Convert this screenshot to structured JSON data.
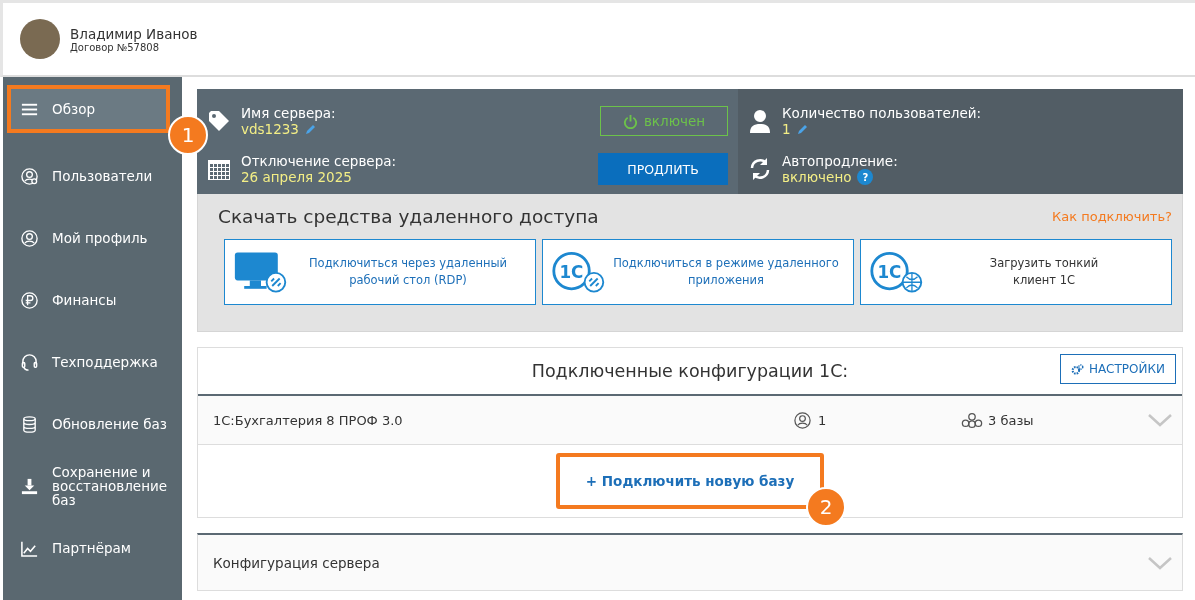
{
  "user": {
    "name": "Владимир Иванов",
    "contract": "Договор №57808"
  },
  "sidebar": {
    "items": [
      {
        "kind": "menu",
        "label": "Обзор",
        "selected": true,
        "callout": "1"
      },
      {
        "kind": "users",
        "label": "Пользователи",
        "selected": false
      },
      {
        "kind": "profile",
        "label": "Мой профиль",
        "selected": false
      },
      {
        "kind": "finance",
        "label": "Финансы",
        "selected": false
      },
      {
        "kind": "support",
        "label": "Техподдержка",
        "selected": false
      },
      {
        "kind": "database",
        "label": "Обновление баз",
        "selected": false
      },
      {
        "kind": "backup",
        "label": "Сохранение и восстановление баз",
        "selected": false
      },
      {
        "kind": "partners",
        "label": "Партнёрам",
        "selected": false
      }
    ]
  },
  "server": {
    "name_label": "Имя сервера:",
    "name": "vds1233",
    "status": "включен",
    "off_label": "Отключение сервера:",
    "off_date": "26 апреля 2025",
    "extend_button": "ПРОДЛИТЬ",
    "users_label": "Количество пользователей:",
    "users": "1",
    "autorenew_label": "Автопродление:",
    "autorenew": "включено",
    "help": "?"
  },
  "download": {
    "title": "Скачать средства удаленного доступа",
    "help_link": "Как подключить?",
    "cards": [
      {
        "kind": "rdp",
        "label": "Подключиться через удаленный рабочий стол (RDP)"
      },
      {
        "kind": "remoteapp",
        "logo": "1C",
        "label": "Подключиться в режиме удаленного приложения"
      },
      {
        "kind": "thin",
        "logo": "1C",
        "label": "Загрузить тонкий клиент 1С"
      }
    ]
  },
  "configs": {
    "title": "Подключенные конфигурации 1С:",
    "settings_button": "НАСТРОЙКИ",
    "rows": [
      {
        "name": "1С:Бухгалтерия 8 ПРОФ 3.0",
        "users": "1",
        "bases": "3 базы",
        "expanded": false
      }
    ],
    "add_button": "+ Подключить новую базу",
    "add_callout": "2"
  },
  "server_config": {
    "title": "Конфигурация сервера",
    "expanded": false
  }
}
